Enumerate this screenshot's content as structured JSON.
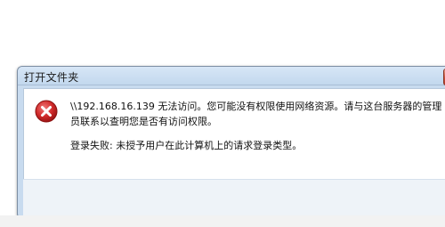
{
  "dialog": {
    "title": "打开文件夹",
    "close_label": "✕",
    "icon": "error-icon",
    "message": "\\\\192.168.16.139 无法访问。您可能没有权限使用网络资源。请与这台服务器的管理员联系以查明您是否有访问权限。",
    "detail": "登录失败: 未授予用户在此计算机上的请求登录类型。"
  },
  "colors": {
    "title_bar": "#c3d8ee",
    "close_button": "#c7513a",
    "error_red": "#d12b2b"
  }
}
